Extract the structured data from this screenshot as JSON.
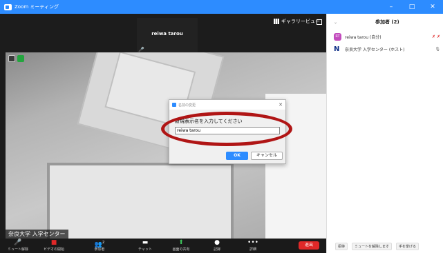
{
  "window": {
    "title": "Zoom ミーティング",
    "min": "–",
    "max": "□",
    "close": "✕"
  },
  "video": {
    "gallery_view_label": "ギャラリービュー",
    "thumbnail_name": "reiwa tarou",
    "active_speaker_name": "奈良大学 入学センター"
  },
  "toolbar": {
    "items": [
      {
        "label": "ミュート解除"
      },
      {
        "label": "ビデオの開始"
      },
      {
        "label": "参加者",
        "count": "2"
      },
      {
        "label": "チャット"
      },
      {
        "label": "画面の共有"
      },
      {
        "label": "記録"
      },
      {
        "label": "詳細"
      }
    ],
    "leave_label": "退出"
  },
  "participants": {
    "header": "参加者 (2)",
    "list": [
      {
        "initials": "RT",
        "name": "reiwa tarou (自分)",
        "avatar_color": "#c24bbd"
      },
      {
        "initials": "N",
        "name": "奈良大学 入学センター (ホスト)",
        "avatar_color": "#0b2b85"
      }
    ],
    "footer": {
      "invite": "招待",
      "mute_all": "ミュートを解除します",
      "raise_hand": "手を挙げる"
    }
  },
  "rename_dialog": {
    "title": "名前の変更",
    "prompt": "新規表示名を入力してください",
    "input_value": "reiwa tarou",
    "ok_label": "OK",
    "cancel_label": "キャンセル"
  },
  "colors": {
    "accent": "#2d8cff",
    "leave": "#e02828",
    "highlight_ring": "#b01515"
  }
}
